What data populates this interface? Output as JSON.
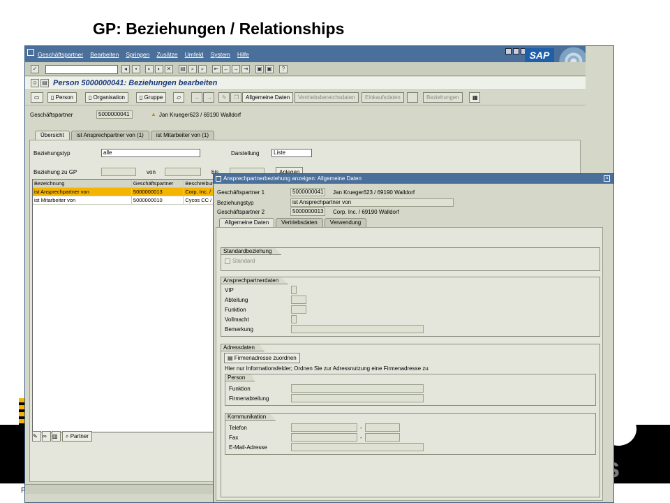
{
  "slide": {
    "title": "GP: Beziehungen / Relationships",
    "footer_fragment": "P"
  },
  "sap": {
    "menu": [
      "Geschäftspartner",
      "Bearbeiten",
      "Springen",
      "Zusätze",
      "Umfeld",
      "System",
      "Hilfe"
    ],
    "logo": "SAP",
    "screen_title": "Person 5000000041: Beziehungen bearbeiten",
    "toolbar_buttons": {
      "person": "Person",
      "organisation": "Organisation",
      "gruppe": "Gruppe",
      "allgemeine_daten": "Allgemeine Daten",
      "vertriebsbereichsdaten": "Vertriebsbereichsdaten",
      "einkaufsdaten": "Einkaufsdaten",
      "beziehungen": "Beziehungen"
    },
    "partner": {
      "label": "Geschäftspartner",
      "value": "5000000041",
      "name": "Jan Krueger623 / 69190 Walldorf"
    },
    "tabs": [
      "Übersicht",
      "ist Ansprechpartner von (1)",
      "ist Mitarbeiter von (1)"
    ],
    "filter": {
      "beziehungstyp_label": "Beziehungstyp",
      "beziehungstyp_value": "alle",
      "darstellung_label": "Darstellung",
      "darstellung_value": "Liste",
      "beziehung_label": "Beziehung zu GP",
      "von_label": "von",
      "bis_label": "bis",
      "anlegen_label": "Anlegen"
    },
    "grid": {
      "headers": [
        "Bezeichnung",
        "Geschäftspartner",
        "Beschreibung"
      ],
      "rows": [
        {
          "bezeichnung": "ist Ansprechpartner von",
          "partner": "5000000013",
          "beschreibung": "Corp. Inc. /"
        },
        {
          "bezeichnung": "ist Mitarbeiter von",
          "partner": "5000000010",
          "beschreibung": "Cycos CC /"
        }
      ]
    },
    "bottom_toolbar": {
      "partner_label": "Partner"
    }
  },
  "popup": {
    "title": "Ansprechpartnerbeziehung anzeigen: Allgemeine Daten",
    "gp1_label": "Geschäftspartner 1",
    "gp1_value": "5000000041",
    "gp1_name": "Jan Krueger623 / 69190 Walldorf",
    "beziehungstyp_label": "Beziehungstyp",
    "beziehungstyp_value": "ist Ansprechpartner von",
    "gp2_label": "Geschäftspartner 2",
    "gp2_value": "5000000013",
    "gp2_name": "Corp. Inc. / 69190 Walldorf",
    "tabs": [
      "Allgemeine Daten",
      "Vertriebsdaten",
      "Verwendung"
    ],
    "standardbeziehung": {
      "caption": "Standardbeziehung",
      "standard_label": "Standard"
    },
    "ansprechpartnerdaten": {
      "caption": "Ansprechpartnerdaten",
      "vip": "VIP",
      "abteilung": "Abteilung",
      "funktion": "Funktion",
      "vollmacht": "Vollmacht",
      "bemerkung": "Bemerkung"
    },
    "adressdaten": {
      "caption": "Adressdaten",
      "button": "Firmenadresse zuordnen",
      "hint": "Hier nur Informationsfelder; Ordnen Sie zur Adressnutzung eine Firmenadresse zu",
      "person_caption": "Person",
      "funktion": "Funktion",
      "firmenabteilung": "Firmenabteilung",
      "kommunikation_caption": "Kommunikation",
      "telefon": "Telefon",
      "fax": "Fax",
      "email": "E-Mail-Adresse",
      "dash": "-"
    }
  }
}
